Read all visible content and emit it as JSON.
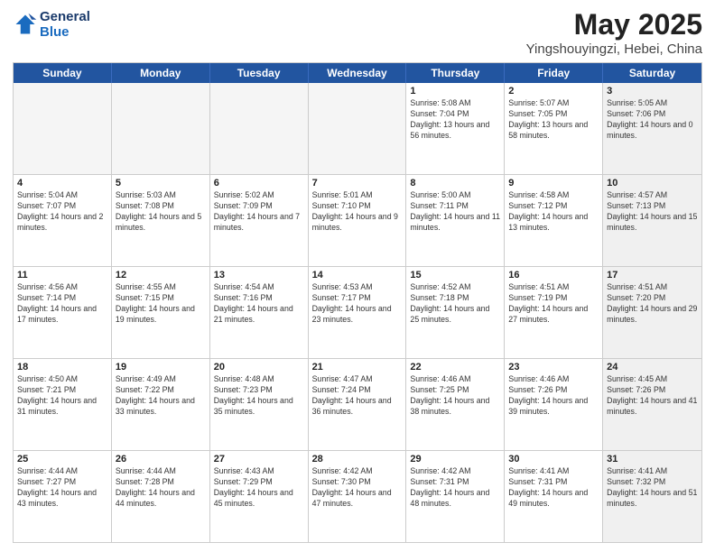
{
  "header": {
    "logo_general": "General",
    "logo_blue": "Blue",
    "month_title": "May 2025",
    "location": "Yingshouyingzi, Hebei, China"
  },
  "weekdays": [
    "Sunday",
    "Monday",
    "Tuesday",
    "Wednesday",
    "Thursday",
    "Friday",
    "Saturday"
  ],
  "rows": [
    [
      {
        "day": "",
        "empty": true
      },
      {
        "day": "",
        "empty": true
      },
      {
        "day": "",
        "empty": true
      },
      {
        "day": "",
        "empty": true
      },
      {
        "day": "1",
        "sunrise": "Sunrise: 5:08 AM",
        "sunset": "Sunset: 7:04 PM",
        "daylight": "Daylight: 13 hours and 56 minutes."
      },
      {
        "day": "2",
        "sunrise": "Sunrise: 5:07 AM",
        "sunset": "Sunset: 7:05 PM",
        "daylight": "Daylight: 13 hours and 58 minutes."
      },
      {
        "day": "3",
        "sunrise": "Sunrise: 5:05 AM",
        "sunset": "Sunset: 7:06 PM",
        "daylight": "Daylight: 14 hours and 0 minutes.",
        "shaded": true
      }
    ],
    [
      {
        "day": "4",
        "sunrise": "Sunrise: 5:04 AM",
        "sunset": "Sunset: 7:07 PM",
        "daylight": "Daylight: 14 hours and 2 minutes."
      },
      {
        "day": "5",
        "sunrise": "Sunrise: 5:03 AM",
        "sunset": "Sunset: 7:08 PM",
        "daylight": "Daylight: 14 hours and 5 minutes."
      },
      {
        "day": "6",
        "sunrise": "Sunrise: 5:02 AM",
        "sunset": "Sunset: 7:09 PM",
        "daylight": "Daylight: 14 hours and 7 minutes."
      },
      {
        "day": "7",
        "sunrise": "Sunrise: 5:01 AM",
        "sunset": "Sunset: 7:10 PM",
        "daylight": "Daylight: 14 hours and 9 minutes."
      },
      {
        "day": "8",
        "sunrise": "Sunrise: 5:00 AM",
        "sunset": "Sunset: 7:11 PM",
        "daylight": "Daylight: 14 hours and 11 minutes."
      },
      {
        "day": "9",
        "sunrise": "Sunrise: 4:58 AM",
        "sunset": "Sunset: 7:12 PM",
        "daylight": "Daylight: 14 hours and 13 minutes."
      },
      {
        "day": "10",
        "sunrise": "Sunrise: 4:57 AM",
        "sunset": "Sunset: 7:13 PM",
        "daylight": "Daylight: 14 hours and 15 minutes.",
        "shaded": true
      }
    ],
    [
      {
        "day": "11",
        "sunrise": "Sunrise: 4:56 AM",
        "sunset": "Sunset: 7:14 PM",
        "daylight": "Daylight: 14 hours and 17 minutes."
      },
      {
        "day": "12",
        "sunrise": "Sunrise: 4:55 AM",
        "sunset": "Sunset: 7:15 PM",
        "daylight": "Daylight: 14 hours and 19 minutes."
      },
      {
        "day": "13",
        "sunrise": "Sunrise: 4:54 AM",
        "sunset": "Sunset: 7:16 PM",
        "daylight": "Daylight: 14 hours and 21 minutes."
      },
      {
        "day": "14",
        "sunrise": "Sunrise: 4:53 AM",
        "sunset": "Sunset: 7:17 PM",
        "daylight": "Daylight: 14 hours and 23 minutes."
      },
      {
        "day": "15",
        "sunrise": "Sunrise: 4:52 AM",
        "sunset": "Sunset: 7:18 PM",
        "daylight": "Daylight: 14 hours and 25 minutes."
      },
      {
        "day": "16",
        "sunrise": "Sunrise: 4:51 AM",
        "sunset": "Sunset: 7:19 PM",
        "daylight": "Daylight: 14 hours and 27 minutes."
      },
      {
        "day": "17",
        "sunrise": "Sunrise: 4:51 AM",
        "sunset": "Sunset: 7:20 PM",
        "daylight": "Daylight: 14 hours and 29 minutes.",
        "shaded": true
      }
    ],
    [
      {
        "day": "18",
        "sunrise": "Sunrise: 4:50 AM",
        "sunset": "Sunset: 7:21 PM",
        "daylight": "Daylight: 14 hours and 31 minutes."
      },
      {
        "day": "19",
        "sunrise": "Sunrise: 4:49 AM",
        "sunset": "Sunset: 7:22 PM",
        "daylight": "Daylight: 14 hours and 33 minutes."
      },
      {
        "day": "20",
        "sunrise": "Sunrise: 4:48 AM",
        "sunset": "Sunset: 7:23 PM",
        "daylight": "Daylight: 14 hours and 35 minutes."
      },
      {
        "day": "21",
        "sunrise": "Sunrise: 4:47 AM",
        "sunset": "Sunset: 7:24 PM",
        "daylight": "Daylight: 14 hours and 36 minutes."
      },
      {
        "day": "22",
        "sunrise": "Sunrise: 4:46 AM",
        "sunset": "Sunset: 7:25 PM",
        "daylight": "Daylight: 14 hours and 38 minutes."
      },
      {
        "day": "23",
        "sunrise": "Sunrise: 4:46 AM",
        "sunset": "Sunset: 7:26 PM",
        "daylight": "Daylight: 14 hours and 39 minutes."
      },
      {
        "day": "24",
        "sunrise": "Sunrise: 4:45 AM",
        "sunset": "Sunset: 7:26 PM",
        "daylight": "Daylight: 14 hours and 41 minutes.",
        "shaded": true
      }
    ],
    [
      {
        "day": "25",
        "sunrise": "Sunrise: 4:44 AM",
        "sunset": "Sunset: 7:27 PM",
        "daylight": "Daylight: 14 hours and 43 minutes."
      },
      {
        "day": "26",
        "sunrise": "Sunrise: 4:44 AM",
        "sunset": "Sunset: 7:28 PM",
        "daylight": "Daylight: 14 hours and 44 minutes."
      },
      {
        "day": "27",
        "sunrise": "Sunrise: 4:43 AM",
        "sunset": "Sunset: 7:29 PM",
        "daylight": "Daylight: 14 hours and 45 minutes."
      },
      {
        "day": "28",
        "sunrise": "Sunrise: 4:42 AM",
        "sunset": "Sunset: 7:30 PM",
        "daylight": "Daylight: 14 hours and 47 minutes."
      },
      {
        "day": "29",
        "sunrise": "Sunrise: 4:42 AM",
        "sunset": "Sunset: 7:31 PM",
        "daylight": "Daylight: 14 hours and 48 minutes."
      },
      {
        "day": "30",
        "sunrise": "Sunrise: 4:41 AM",
        "sunset": "Sunset: 7:31 PM",
        "daylight": "Daylight: 14 hours and 49 minutes."
      },
      {
        "day": "31",
        "sunrise": "Sunrise: 4:41 AM",
        "sunset": "Sunset: 7:32 PM",
        "daylight": "Daylight: 14 hours and 51 minutes.",
        "shaded": true
      }
    ]
  ]
}
